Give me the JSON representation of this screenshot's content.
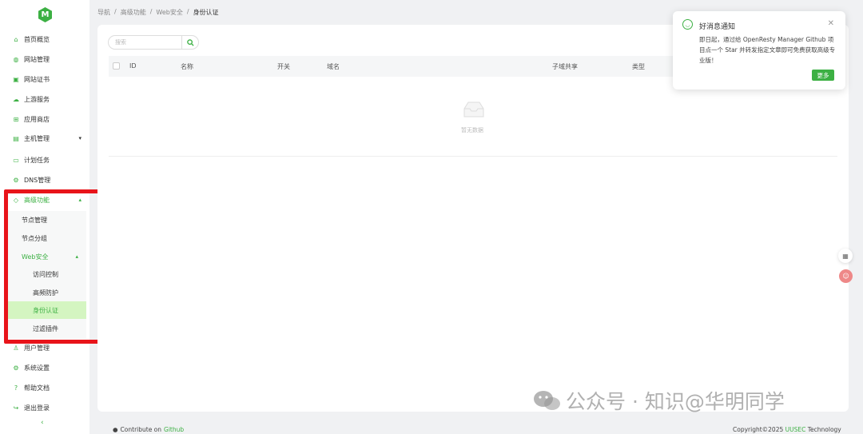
{
  "sidebar": {
    "logo_letter": "M",
    "items": [
      {
        "label": "首页概览",
        "icon": "home-icon"
      },
      {
        "label": "网站管理",
        "icon": "globe-icon"
      },
      {
        "label": "网站证书",
        "icon": "certificate-icon"
      },
      {
        "label": "上游服务",
        "icon": "cloud-icon"
      },
      {
        "label": "应用商店",
        "icon": "apps-icon"
      },
      {
        "label": "主机管理",
        "icon": "server-icon"
      },
      {
        "label": "计划任务",
        "icon": "calendar-icon"
      },
      {
        "label": "DNS管理",
        "icon": "dns-icon"
      },
      {
        "label": "高级功能",
        "icon": "diamond-icon"
      },
      {
        "label": "用户管理",
        "icon": "user-icon"
      },
      {
        "label": "系统设置",
        "icon": "gear-icon"
      },
      {
        "label": "帮助文档",
        "icon": "help-icon"
      },
      {
        "label": "退出登录",
        "icon": "logout-icon"
      }
    ],
    "advanced_sub": [
      "节点管理",
      "节点分组",
      "Web安全"
    ],
    "websec_sub": [
      "访问控制",
      "高频防护",
      "身份认证",
      "过滤插件"
    ]
  },
  "breadcrumb": [
    "导航",
    "高级功能",
    "Web安全",
    "身份认证"
  ],
  "search": {
    "placeholder": "搜索"
  },
  "table": {
    "columns": [
      "ID",
      "名称",
      "开关",
      "域名",
      "子域共享",
      "类型"
    ],
    "empty_text": "暂无数据"
  },
  "notification": {
    "title": "好消息通知",
    "body": "即日起，通过给 OpenResty Manager Github 项目点一个 Star 并转发指定文章即可免费获取高级专业版！",
    "more_label": "更多"
  },
  "footer": {
    "contribute_prefix": "Contribute on",
    "contribute_link": "Github",
    "copyright_prefix": "Copyright©2025",
    "brand": "UUSEC",
    "copyright_suffix": "Technology"
  },
  "watermark": {
    "text": "公众号 · 知识@华明同学"
  },
  "colors": {
    "accent": "#3cb043",
    "highlight": "#e8141a",
    "active_bg": "#d4f5c1"
  }
}
